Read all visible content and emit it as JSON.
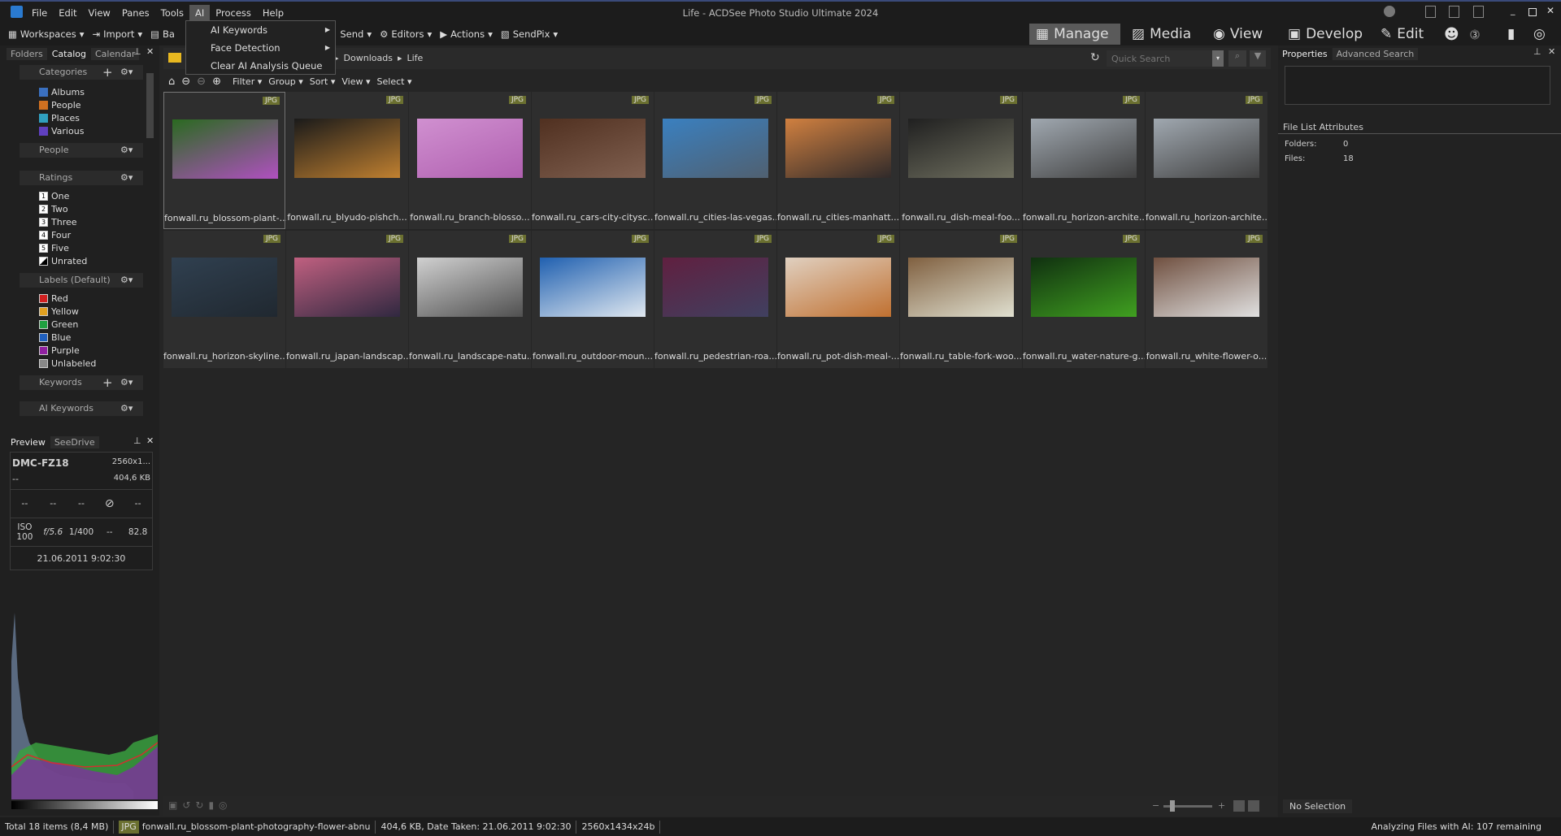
{
  "window": {
    "title": "Life - ACDSee Photo Studio Ultimate 2024"
  },
  "menu": [
    "File",
    "Edit",
    "View",
    "Panes",
    "Tools",
    "AI",
    "Process",
    "Help"
  ],
  "ai_menu": [
    {
      "label": "AI Keywords",
      "submenu": true
    },
    {
      "label": "Face Detection",
      "submenu": true
    },
    {
      "label": "Clear AI Analysis Queue",
      "submenu": false
    }
  ],
  "toolbar": {
    "workspaces": "Workspaces",
    "import": "Import",
    "batch": "Ba",
    "send": "Send",
    "editors": "Editors",
    "actions": "Actions",
    "sendpix": "SendPix"
  },
  "modes": [
    "Manage",
    "Media",
    "View",
    "Develop",
    "Edit"
  ],
  "left_tabs": [
    "Folders",
    "Catalog",
    "Calendar"
  ],
  "catalog": {
    "categories_title": "Categories",
    "categories": [
      "Albums",
      "People",
      "Places",
      "Various"
    ],
    "people_title": "People",
    "ratings_title": "Ratings",
    "ratings": [
      {
        "num": "1",
        "label": "One"
      },
      {
        "num": "2",
        "label": "Two"
      },
      {
        "num": "3",
        "label": "Three"
      },
      {
        "num": "4",
        "label": "Four"
      },
      {
        "num": "5",
        "label": "Five"
      },
      {
        "num": "",
        "label": "Unrated"
      }
    ],
    "labels_title": "Labels (Default)",
    "labels": [
      {
        "label": "Red",
        "color": "#d02020"
      },
      {
        "label": "Yellow",
        "color": "#e0a020"
      },
      {
        "label": "Green",
        "color": "#20a040"
      },
      {
        "label": "Blue",
        "color": "#2060c0"
      },
      {
        "label": "Purple",
        "color": "#9020a0"
      },
      {
        "label": "Unlabeled",
        "color": "#888888"
      }
    ],
    "keywords_title": "Keywords",
    "ai_keywords_title": "AI Keywords"
  },
  "breadcrumb": [
    "Downloads",
    "Life"
  ],
  "quick_search": {
    "placeholder": "Quick Search"
  },
  "filterbar": [
    "Filter",
    "Group",
    "Sort",
    "View",
    "Select"
  ],
  "files": [
    {
      "name": "fonwall.ru_blossom-plant-...",
      "type": "JPG",
      "colors": [
        "#2a6a20",
        "#b050c0"
      ]
    },
    {
      "name": "fonwall.ru_blyudo-pishch...",
      "type": "JPG",
      "colors": [
        "#1a1a1a",
        "#c08030"
      ]
    },
    {
      "name": "fonwall.ru_branch-blosso...",
      "type": "JPG",
      "colors": [
        "#d090d0",
        "#b060b0"
      ]
    },
    {
      "name": "fonwall.ru_cars-city-citysc...",
      "type": "JPG",
      "colors": [
        "#503020",
        "#806050"
      ]
    },
    {
      "name": "fonwall.ru_cities-las-vegas...",
      "type": "JPG",
      "colors": [
        "#3a80c0",
        "#506070"
      ]
    },
    {
      "name": "fonwall.ru_cities-manhatt...",
      "type": "JPG",
      "colors": [
        "#d08040",
        "#302a2a"
      ]
    },
    {
      "name": "fonwall.ru_dish-meal-foo...",
      "type": "JPG",
      "colors": [
        "#202020",
        "#707060"
      ]
    },
    {
      "name": "fonwall.ru_horizon-archite...",
      "type": "JPG",
      "colors": [
        "#a0a8b0",
        "#404040"
      ]
    },
    {
      "name": "fonwall.ru_horizon-archite...",
      "type": "JPG",
      "colors": [
        "#a0a8b0",
        "#404040"
      ]
    },
    {
      "name": "fonwall.ru_horizon-skyline...",
      "type": "JPG",
      "colors": [
        "#304050",
        "#202830"
      ]
    },
    {
      "name": "fonwall.ru_japan-landscap...",
      "type": "JPG",
      "colors": [
        "#c06080",
        "#302840"
      ]
    },
    {
      "name": "fonwall.ru_landscape-natu...",
      "type": "JPG",
      "colors": [
        "#d0d0d0",
        "#505050"
      ]
    },
    {
      "name": "fonwall.ru_outdoor-moun...",
      "type": "JPG",
      "colors": [
        "#2060b0",
        "#e0e8f0"
      ]
    },
    {
      "name": "fonwall.ru_pedestrian-roa...",
      "type": "JPG",
      "colors": [
        "#602040",
        "#404060"
      ]
    },
    {
      "name": "fonwall.ru_pot-dish-meal-...",
      "type": "JPG",
      "colors": [
        "#e0d0c0",
        "#c07030"
      ]
    },
    {
      "name": "fonwall.ru_table-fork-woo...",
      "type": "JPG",
      "colors": [
        "#806040",
        "#e0e0d0"
      ]
    },
    {
      "name": "fonwall.ru_water-nature-g...",
      "type": "JPG",
      "colors": [
        "#103010",
        "#40a020"
      ]
    },
    {
      "name": "fonwall.ru_white-flower-o...",
      "type": "JPG",
      "colors": [
        "#705040",
        "#e0e0e0"
      ]
    }
  ],
  "preview": {
    "tabs": [
      "Preview",
      "SeeDrive"
    ],
    "camera": "DMC-FZ18",
    "dims": "2560x1...",
    "lens": "--",
    "size": "404,6 KB",
    "row1": [
      "--",
      "--",
      "--",
      "--"
    ],
    "iso_label": "ISO",
    "iso": "100",
    "aperture": "f/5.6",
    "shutter": "1/400",
    "ev": "--",
    "focal": "82.8",
    "date": "21.06.2011 9:02:30"
  },
  "properties": {
    "tabs": [
      "Properties",
      "Advanced Search"
    ],
    "section": "File List Attributes",
    "folders_label": "Folders:",
    "folders": "0",
    "files_label": "Files:",
    "files": "18",
    "no_selection": "No Selection"
  },
  "status": {
    "total": "Total 18 items  (8,4 MB)",
    "type": "JPG",
    "file": "fonwall.ru_blossom-plant-photography-flower-abnu",
    "info": "404,6 KB, Date Taken: 21.06.2011 9:02:30",
    "dims": "2560x1434x24b",
    "ai": "Analyzing Files with AI: 107 remaining"
  }
}
